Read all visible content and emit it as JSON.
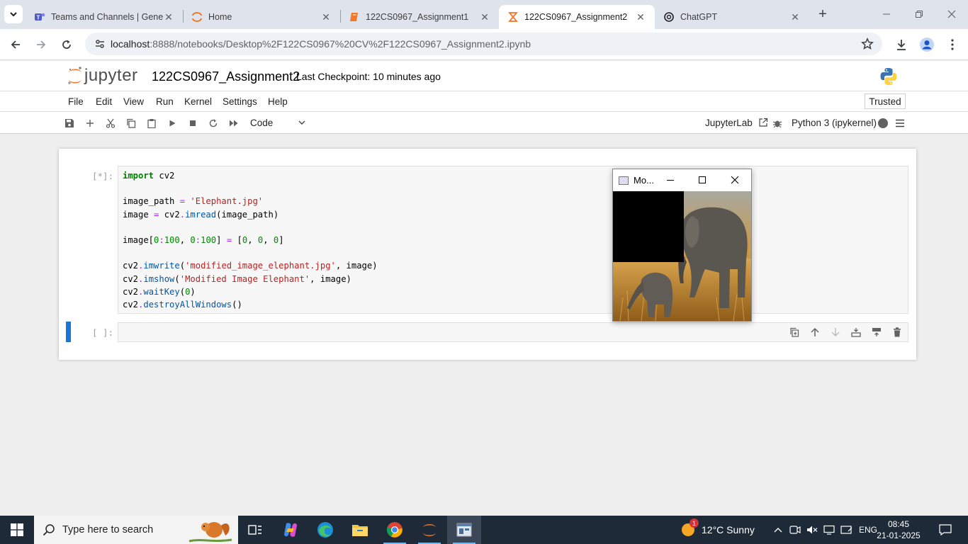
{
  "browser": {
    "tabs": [
      {
        "title": "Teams and Channels | General",
        "icon": "teams-icon",
        "active": false
      },
      {
        "title": "Home",
        "icon": "jupyter-icon",
        "active": false
      },
      {
        "title": "122CS0967_Assignment1",
        "icon": "notebook-icon",
        "active": false
      },
      {
        "title": "122CS0967_Assignment2",
        "icon": "hourglass-icon",
        "active": true
      },
      {
        "title": "ChatGPT",
        "icon": "chatgpt-icon",
        "active": false
      }
    ],
    "url_host": "localhost",
    "url_rest": ":8888/notebooks/Desktop%2F122CS0967%20CV%2F122CS0967_Assignment2.ipynb"
  },
  "jupyter": {
    "logo_text": "jupyter",
    "notebook_name": "122CS0967_Assignment2",
    "checkpoint": "Last Checkpoint: 10 minutes ago",
    "menu": [
      "File",
      "Edit",
      "View",
      "Run",
      "Kernel",
      "Settings",
      "Help"
    ],
    "trusted": "Trusted",
    "cell_type": "Code",
    "jupyterlab": "JupyterLab",
    "kernel": "Python 3 (ipykernel)"
  },
  "cells": [
    {
      "prompt": "[*]:"
    },
    {
      "prompt": "[ ]:"
    }
  ],
  "cv_window": {
    "title": "Mo..."
  },
  "taskbar": {
    "search_placeholder": "Type here to search",
    "weather": "12°C  Sunny",
    "weather_badge": "1",
    "lang": "ENG",
    "time": "08:45",
    "date": "21-01-2025"
  },
  "colors": {
    "accent": "#1976d2",
    "jupyter_orange": "#f37726"
  }
}
